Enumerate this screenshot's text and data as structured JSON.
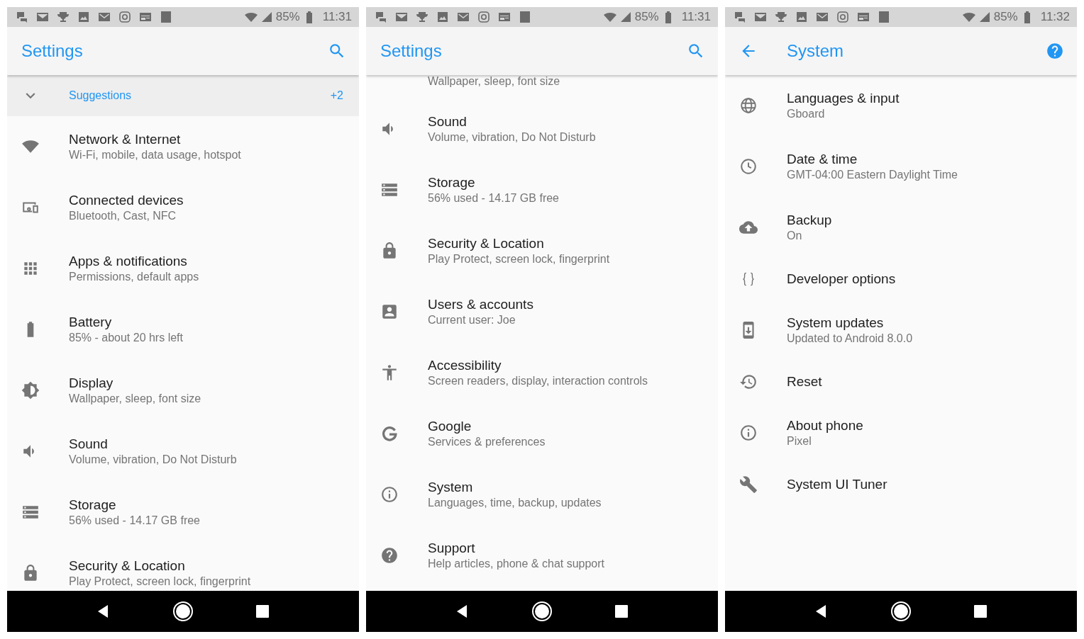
{
  "phones": [
    {
      "status_bar": {
        "battery": "85%",
        "time": "11:31"
      },
      "app_bar": {
        "kind": "root",
        "title": "Settings"
      },
      "suggestions": {
        "label": "Suggestions",
        "count": "+2"
      },
      "items": [
        {
          "kind": "row",
          "title": "Network & Internet",
          "subtitle": "Wi-Fi, mobile, data usage, hotspot"
        },
        {
          "kind": "row",
          "title": "Connected devices",
          "subtitle": "Bluetooth, Cast, NFC"
        },
        {
          "kind": "row",
          "title": "Apps & notifications",
          "subtitle": "Permissions, default apps"
        },
        {
          "kind": "row",
          "title": "Battery",
          "subtitle": "85% - about 20 hrs left"
        },
        {
          "kind": "row",
          "title": "Display",
          "subtitle": "Wallpaper, sleep, font size"
        },
        {
          "kind": "row",
          "title": "Sound",
          "subtitle": "Volume, vibration, Do Not Disturb"
        },
        {
          "kind": "row",
          "title": "Storage",
          "subtitle": "56% used - 14.17 GB free"
        },
        {
          "kind": "row",
          "title": "Security & Location",
          "subtitle": "Play Protect, screen lock, fingerprint"
        }
      ]
    },
    {
      "status_bar": {
        "battery": "85%",
        "time": "11:31"
      },
      "app_bar": {
        "kind": "root",
        "title": "Settings"
      },
      "items": [
        {
          "kind": "clipped",
          "subtitle": "Wallpaper, sleep, font size"
        },
        {
          "kind": "row",
          "title": "Sound",
          "subtitle": "Volume, vibration, Do Not Disturb"
        },
        {
          "kind": "row",
          "title": "Storage",
          "subtitle": "56% used - 14.17 GB free"
        },
        {
          "kind": "row",
          "title": "Security & Location",
          "subtitle": "Play Protect, screen lock, fingerprint"
        },
        {
          "kind": "row",
          "title": "Users & accounts",
          "subtitle": "Current user: Joe"
        },
        {
          "kind": "row",
          "title": "Accessibility",
          "subtitle": "Screen readers, display, interaction controls"
        },
        {
          "kind": "row",
          "title": "Google",
          "subtitle": "Services & preferences"
        },
        {
          "kind": "row",
          "title": "System",
          "subtitle": "Languages, time, backup, updates"
        },
        {
          "kind": "row",
          "title": "Support",
          "subtitle": "Help articles, phone & chat support"
        }
      ]
    },
    {
      "status_bar": {
        "battery": "85%",
        "time": "11:32"
      },
      "app_bar": {
        "kind": "sub",
        "title": "System"
      },
      "items": [
        {
          "kind": "row",
          "title": "Languages & input",
          "subtitle": "Gboard"
        },
        {
          "kind": "row",
          "title": "Date & time",
          "subtitle": "GMT-04:00 Eastern Daylight Time"
        },
        {
          "kind": "row",
          "title": "Backup",
          "subtitle": "On"
        },
        {
          "kind": "row",
          "title": "Developer options"
        },
        {
          "kind": "row",
          "title": "System updates",
          "subtitle": "Updated to Android 8.0.0"
        },
        {
          "kind": "row",
          "title": "Reset"
        },
        {
          "kind": "row",
          "title": "About phone",
          "subtitle": "Pixel"
        },
        {
          "kind": "row",
          "title": "System UI Tuner"
        }
      ]
    }
  ]
}
